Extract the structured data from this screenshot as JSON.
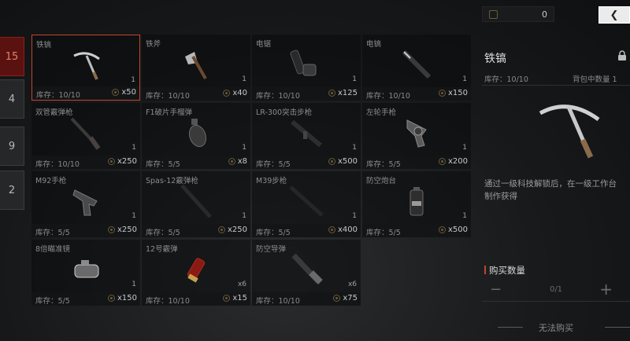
{
  "tabs": [
    {
      "label": "15",
      "active": true
    },
    {
      "label": "4",
      "active": false
    },
    {
      "label": "9",
      "active": false
    },
    {
      "label": "2",
      "active": false
    }
  ],
  "items": [
    {
      "name": "铁镐",
      "qty": "1",
      "stock": "库存：10/10",
      "price": "x50",
      "icon": "pickaxe-icon",
      "selected": true
    },
    {
      "name": "铁斧",
      "qty": "1",
      "stock": "库存：10/10",
      "price": "x40",
      "icon": "axe-icon"
    },
    {
      "name": "电锯",
      "qty": "1",
      "stock": "库存：10/10",
      "price": "x125",
      "icon": "chainsaw-icon"
    },
    {
      "name": "电镐",
      "qty": "1",
      "stock": "库存：10/10",
      "price": "x150",
      "icon": "power-pick-icon"
    },
    {
      "name": "双管霰弹枪",
      "qty": "1",
      "stock": "库存：10/10",
      "price": "x250",
      "icon": "double-barrel-shotgun-icon"
    },
    {
      "name": "F1破片手榴弹",
      "qty": "1",
      "stock": "库存：5/5",
      "price": "x8",
      "icon": "grenade-icon"
    },
    {
      "name": "LR-300突击步枪",
      "qty": "1",
      "stock": "库存：5/5",
      "price": "x500",
      "icon": "assault-rifle-icon"
    },
    {
      "name": "左轮手枪",
      "qty": "1",
      "stock": "库存：5/5",
      "price": "x200",
      "icon": "revolver-icon"
    },
    {
      "name": "M92手枪",
      "qty": "1",
      "stock": "库存：5/5",
      "price": "x250",
      "icon": "pistol-icon"
    },
    {
      "name": "Spas-12霰弹枪",
      "qty": "1",
      "stock": "库存：5/5",
      "price": "x250",
      "icon": "shotgun-icon"
    },
    {
      "name": "M39步枪",
      "qty": "1",
      "stock": "库存：5/5",
      "price": "x400",
      "icon": "rifle-icon"
    },
    {
      "name": "防空炮台",
      "qty": "1",
      "stock": "库存：5/5",
      "price": "x500",
      "icon": "sam-turret-icon"
    },
    {
      "name": "8倍瞄准镜",
      "qty": "1",
      "stock": "库存：5/5",
      "price": "x150",
      "icon": "scope-icon"
    },
    {
      "name": "12号霰弹",
      "qty": "x6",
      "stock": "库存：10/10",
      "price": "x15",
      "icon": "shotgun-shell-icon"
    },
    {
      "name": "防空导弹",
      "qty": "x6",
      "stock": "库存：10/10",
      "price": "x75",
      "icon": "missile-icon"
    }
  ],
  "currency": {
    "value": "0"
  },
  "detail": {
    "title": "铁镐",
    "stock": "库存：10/10",
    "bag_count": "背包中数量 1",
    "description_line1": "通过一级科技解锁后，在一级工作台",
    "description_line2": "制作获得"
  },
  "purchase": {
    "label": "购买数量",
    "minus": "−",
    "value": "0/1",
    "plus": "+",
    "cant_buy": "无法购买"
  },
  "colors": {
    "accent": "#c0472e",
    "active_tab": "#5a1210"
  }
}
